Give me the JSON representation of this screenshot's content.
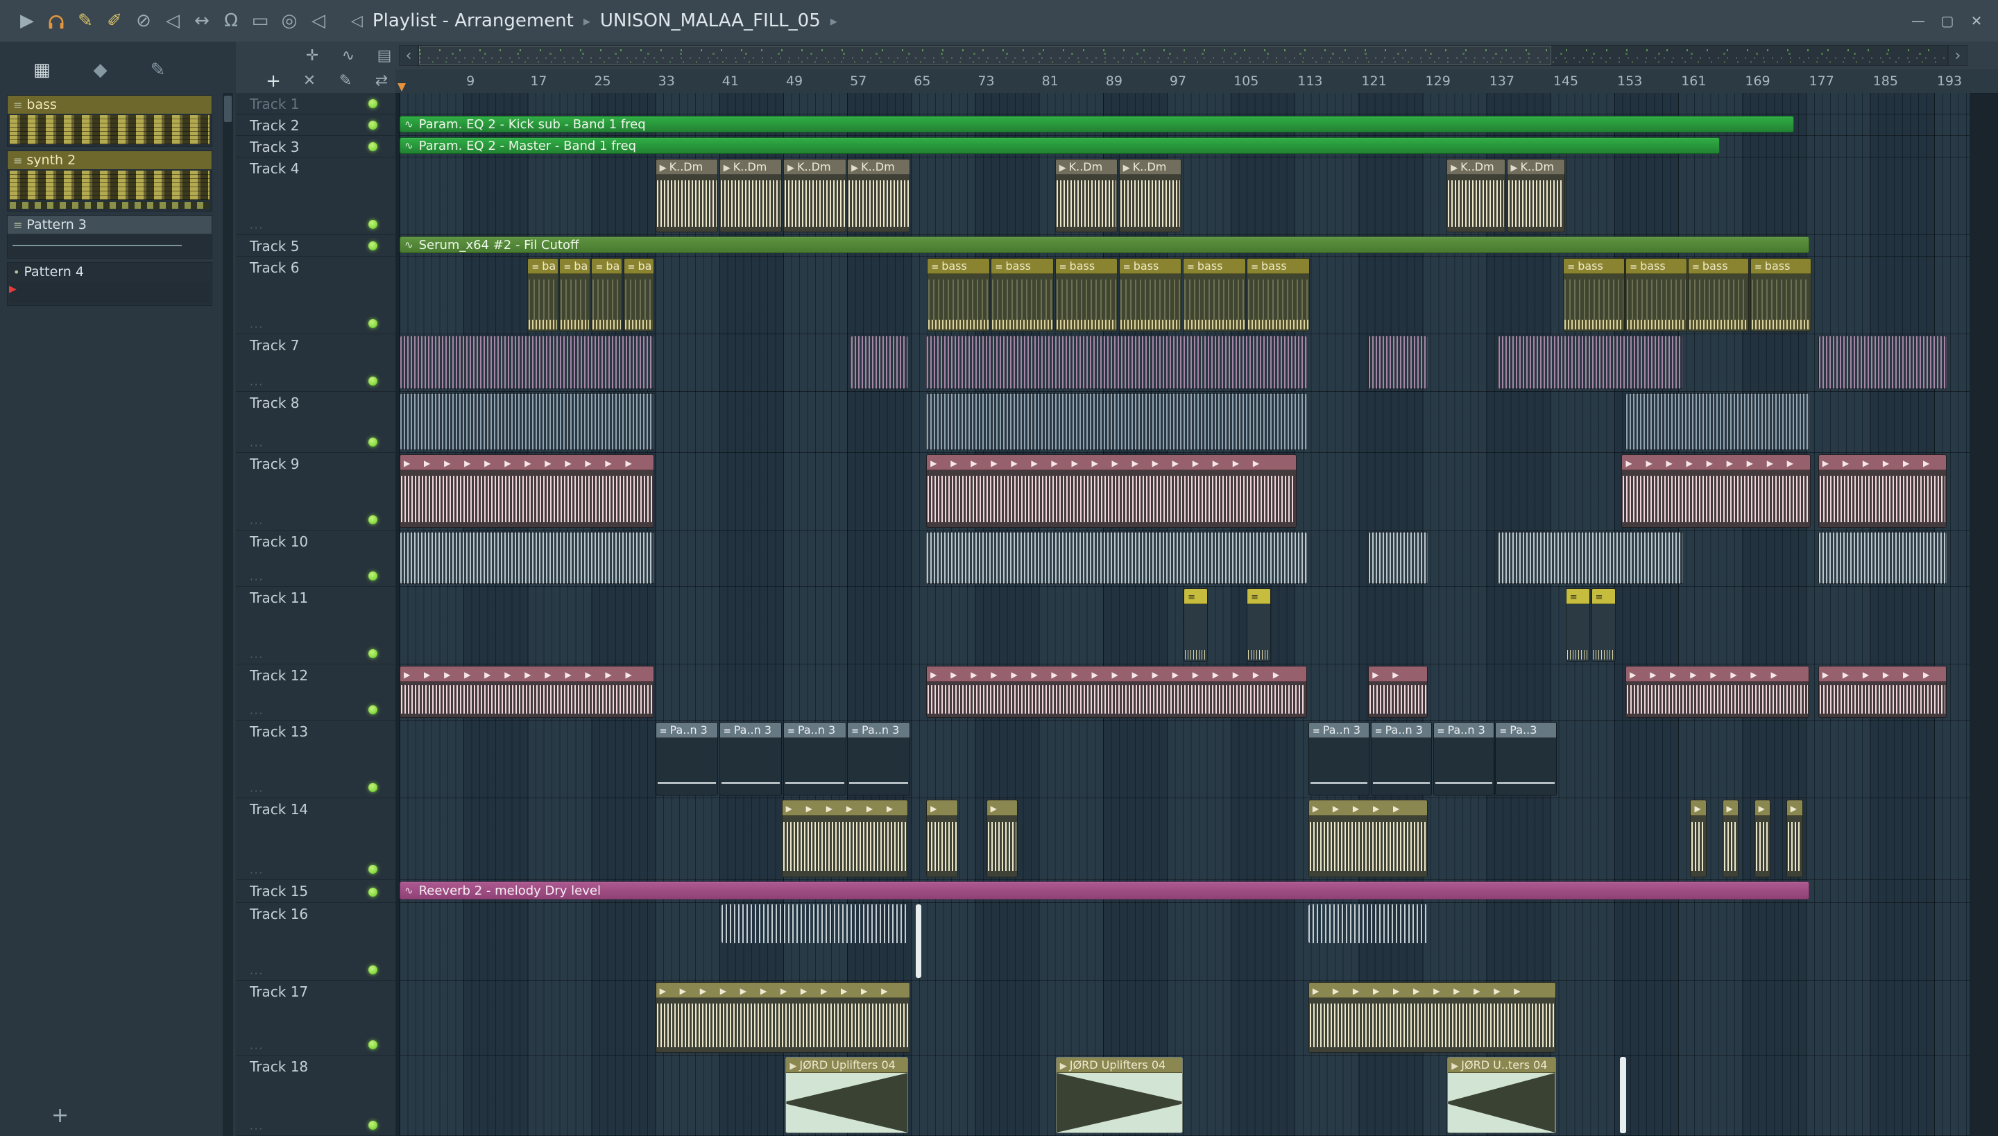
{
  "titlebar": {
    "title": "Playlist - Arrangement",
    "separator": "▸",
    "subtitle": "UNISON_MALAA_FILL_05",
    "speaker_glyph": "◁",
    "window_buttons": {
      "minimize": "—",
      "maximize": "▢",
      "close": "✕"
    },
    "icons": [
      {
        "name": "play",
        "glyph": "▶"
      },
      {
        "name": "headphones",
        "glyph": "svg"
      },
      {
        "name": "pencil",
        "glyph": "✎",
        "warn": true
      },
      {
        "name": "brush",
        "glyph": "✐",
        "warn": true
      },
      {
        "name": "slip",
        "glyph": "⊘"
      },
      {
        "name": "mute",
        "glyph": "◁"
      },
      {
        "name": "stretch",
        "glyph": "↔"
      },
      {
        "name": "magnet",
        "glyph": "Ω"
      },
      {
        "name": "zoom-frame",
        "glyph": "▭"
      },
      {
        "name": "zoom",
        "glyph": "◎"
      },
      {
        "name": "preview-speaker",
        "glyph": "◁"
      }
    ]
  },
  "pattern_picker": {
    "tools": [
      {
        "name": "grid",
        "glyph": "▦",
        "bright": true
      },
      {
        "name": "diamond",
        "glyph": "◆"
      },
      {
        "name": "pencil",
        "glyph": "✎"
      }
    ],
    "items": [
      {
        "label": "bass",
        "kind": "notes",
        "icon": "≡"
      },
      {
        "label": "synth 2",
        "kind": "notes2",
        "icon": "≡"
      },
      {
        "label": "Pattern 3",
        "kind": "empty",
        "icon": "≡"
      },
      {
        "label": "Pattern 4",
        "kind": "audio",
        "icon": "•"
      }
    ],
    "add_button": "+"
  },
  "playlist_tools": {
    "row1": [
      {
        "name": "move",
        "glyph": "✛"
      },
      {
        "name": "slide",
        "glyph": "∿"
      },
      {
        "name": "piano",
        "glyph": "▤"
      }
    ],
    "row2": [
      {
        "name": "add",
        "glyph": "+",
        "accent": true
      },
      {
        "name": "cut",
        "glyph": "✕"
      },
      {
        "name": "draw",
        "glyph": "✎"
      },
      {
        "name": "swap",
        "glyph": "⇄"
      }
    ]
  },
  "scrollbar": {
    "left_arrow": "‹",
    "right_arrow": "›"
  },
  "timeline": {
    "labels": [
      9,
      17,
      25,
      33,
      41,
      49,
      57,
      65,
      73,
      81,
      89,
      97,
      105,
      113,
      121,
      129,
      137,
      145,
      153,
      161,
      169,
      177,
      185,
      193
    ]
  },
  "tracks": [
    {
      "name": "Track 1",
      "h": 31,
      "dim": true
    },
    {
      "name": "Track 2",
      "h": 31
    },
    {
      "name": "Track 3",
      "h": 31
    },
    {
      "name": "Track 4",
      "h": 112
    },
    {
      "name": "Track 5",
      "h": 31
    },
    {
      "name": "Track 6",
      "h": 112
    },
    {
      "name": "Track 7",
      "h": 83
    },
    {
      "name": "Track 8",
      "h": 88
    },
    {
      "name": "Track 9",
      "h": 112
    },
    {
      "name": "Track 10",
      "h": 81
    },
    {
      "name": "Track 11",
      "h": 112
    },
    {
      "name": "Track 12",
      "h": 81
    },
    {
      "name": "Track 13",
      "h": 112
    },
    {
      "name": "Track 14",
      "h": 118
    },
    {
      "name": "Track 15",
      "h": 33
    },
    {
      "name": "Track 16",
      "h": 112
    },
    {
      "name": "Track 17",
      "h": 108
    },
    {
      "name": "Track 18",
      "h": 116
    }
  ],
  "palette": {
    "auto_green": {
      "fill": "#2fae44",
      "fill2": "#238233",
      "border": "#0f5c1e",
      "icon": "∿",
      "text": "#eef7ea"
    },
    "auto_olive": {
      "fill": "#5e9440",
      "fill2": "#497a30",
      "border": "#2f5a1c",
      "icon": "∿",
      "text": "#eef7ea"
    },
    "auto_purple": {
      "fill": "#ad5890",
      "fill2": "#8f4276",
      "border": "#6b2f58",
      "icon": "∿",
      "text": "#f7eef4"
    },
    "bass": {
      "hdr": "#8a8430",
      "body": "#3f4530",
      "bars": "#d8d2a0",
      "icon": "≡",
      "text": "#efe9c8"
    },
    "kick": {
      "hdr": "#716e5e",
      "body": "#3e4036",
      "bars": "#ece6ca",
      "icon": "▶",
      "text": "#efe9d8"
    },
    "stripe_purple": {
      "a": "#a386a8",
      "b": "#2a3640"
    },
    "stripe_blue": {
      "a": "#8fa3b2",
      "b": "#2a3640"
    },
    "stripe_light": {
      "a": "#b9c6cd",
      "b": "#2f3d46"
    },
    "wave_pink": {
      "hdr": "#96606c",
      "body": "#433a3e",
      "bars": "#f0d6da",
      "text": "#f6e8ea"
    },
    "yellow_sm": {
      "hdr": "#c6bd3e",
      "body": "#2b3a43",
      "bars": "#ded8a8",
      "icon": "≡",
      "text": "#2e2e1a"
    },
    "pat3": {
      "hdr": "#667882",
      "body": "#22303a",
      "icon": "≡",
      "text": "#e8eef2"
    },
    "wave_olive": {
      "hdr": "#8a8750",
      "body": "#3e4236",
      "bars": "#ece6ca",
      "text": "#f0ead2"
    },
    "wave_thin": {
      "bars": "#c4ced2"
    },
    "uplift": {
      "hdr": "#8a8750",
      "body": "#d2e4d4",
      "ramp": "#3a4234",
      "icon": "▶",
      "text": "#f0ead2"
    },
    "sliver": {
      "fill": "#e8eef0"
    }
  },
  "clips": [
    {
      "t": 2,
      "s": 1,
      "l": 174.6,
      "k": "auto_green",
      "label": "Param. EQ 2 - Kick sub - Band 1 freq"
    },
    {
      "t": 3,
      "s": 1,
      "l": 165.3,
      "k": "auto_green",
      "label": "Param. EQ 2 - Master - Band 1 freq"
    },
    {
      "t": 4,
      "s": 33,
      "l": 8,
      "k": "kick",
      "label": "K..Dm"
    },
    {
      "t": 4,
      "s": 41,
      "l": 8,
      "k": "kick",
      "label": "K..Dm"
    },
    {
      "t": 4,
      "s": 49,
      "l": 8,
      "k": "kick",
      "label": "K..Dm"
    },
    {
      "t": 4,
      "s": 57,
      "l": 8,
      "k": "kick",
      "label": "K..Dm"
    },
    {
      "t": 4,
      "s": 83,
      "l": 8,
      "k": "kick",
      "label": "K..Dm"
    },
    {
      "t": 4,
      "s": 91,
      "l": 8,
      "k": "kick",
      "label": "K..Dm"
    },
    {
      "t": 4,
      "s": 132,
      "l": 7.5,
      "k": "kick",
      "label": "K..Dm"
    },
    {
      "t": 4,
      "s": 139.5,
      "l": 7.5,
      "k": "kick",
      "label": "K..Dm"
    },
    {
      "t": 5,
      "s": 1,
      "l": 176.5,
      "k": "auto_olive",
      "label": "Serum_x64 #2 - Fil Cutoff"
    },
    {
      "t": 6,
      "s": 17,
      "l": 4,
      "k": "bass",
      "label": "ba"
    },
    {
      "t": 6,
      "s": 21,
      "l": 4,
      "k": "bass",
      "label": "ba"
    },
    {
      "t": 6,
      "s": 25,
      "l": 4,
      "k": "bass",
      "label": "ba"
    },
    {
      "t": 6,
      "s": 29,
      "l": 4,
      "k": "bass",
      "label": "ba"
    },
    {
      "t": 6,
      "s": 67,
      "l": 8,
      "k": "bass",
      "label": "bass"
    },
    {
      "t": 6,
      "s": 75,
      "l": 8,
      "k": "bass",
      "label": "bass"
    },
    {
      "t": 6,
      "s": 83,
      "l": 8,
      "k": "bass",
      "label": "bass"
    },
    {
      "t": 6,
      "s": 91,
      "l": 8,
      "k": "bass",
      "label": "bass"
    },
    {
      "t": 6,
      "s": 99,
      "l": 8,
      "k": "bass",
      "label": "bass"
    },
    {
      "t": 6,
      "s": 107,
      "l": 8,
      "k": "bass",
      "label": "bass"
    },
    {
      "t": 6,
      "s": 146.6,
      "l": 7.8,
      "k": "bass",
      "label": "bass"
    },
    {
      "t": 6,
      "s": 154.4,
      "l": 7.8,
      "k": "bass",
      "label": "bass"
    },
    {
      "t": 6,
      "s": 162.2,
      "l": 7.8,
      "k": "bass",
      "label": "bass"
    },
    {
      "t": 6,
      "s": 170,
      "l": 7.8,
      "k": "bass",
      "label": "bass"
    },
    {
      "t": 7,
      "s": 1,
      "l": 32,
      "k": "stripe_purple"
    },
    {
      "t": 7,
      "s": 57.4,
      "l": 7.4,
      "k": "stripe_purple"
    },
    {
      "t": 7,
      "s": 66.9,
      "l": 47.8,
      "k": "stripe_purple"
    },
    {
      "t": 7,
      "s": 122.2,
      "l": 7.6,
      "k": "stripe_purple"
    },
    {
      "t": 7,
      "s": 138.4,
      "l": 23.3,
      "k": "stripe_purple"
    },
    {
      "t": 7,
      "s": 178.5,
      "l": 16.2,
      "k": "stripe_purple"
    },
    {
      "t": 8,
      "s": 1,
      "l": 32,
      "k": "stripe_blue"
    },
    {
      "t": 8,
      "s": 66.9,
      "l": 47.8,
      "k": "stripe_blue"
    },
    {
      "t": 8,
      "s": 154.4,
      "l": 23.1,
      "k": "stripe_blue"
    },
    {
      "t": 9,
      "s": 1,
      "l": 32,
      "k": "wave_pink"
    },
    {
      "t": 9,
      "s": 66.9,
      "l": 46.5,
      "k": "wave_pink"
    },
    {
      "t": 9,
      "s": 153.9,
      "l": 23.8,
      "k": "wave_pink"
    },
    {
      "t": 9,
      "s": 178.5,
      "l": 16.2,
      "k": "wave_pink"
    },
    {
      "t": 10,
      "s": 1,
      "l": 32,
      "k": "stripe_light"
    },
    {
      "t": 10,
      "s": 66.9,
      "l": 47.8,
      "k": "stripe_light"
    },
    {
      "t": 10,
      "s": 122.2,
      "l": 7.6,
      "k": "stripe_light"
    },
    {
      "t": 10,
      "s": 138.4,
      "l": 23.3,
      "k": "stripe_light"
    },
    {
      "t": 10,
      "s": 178.5,
      "l": 16.2,
      "k": "stripe_light"
    },
    {
      "t": 11,
      "s": 99.1,
      "l": 3.2,
      "k": "yellow_sm"
    },
    {
      "t": 11,
      "s": 107,
      "l": 3.2,
      "k": "yellow_sm"
    },
    {
      "t": 11,
      "s": 146.9,
      "l": 3.2,
      "k": "yellow_sm"
    },
    {
      "t": 11,
      "s": 150.1,
      "l": 3.2,
      "k": "yellow_sm"
    },
    {
      "t": 12,
      "s": 1,
      "l": 32,
      "k": "wave_pink"
    },
    {
      "t": 12,
      "s": 66.9,
      "l": 47.8,
      "k": "wave_pink"
    },
    {
      "t": 12,
      "s": 122.2,
      "l": 7.6,
      "k": "wave_pink"
    },
    {
      "t": 12,
      "s": 154.4,
      "l": 23.1,
      "k": "wave_pink"
    },
    {
      "t": 12,
      "s": 178.5,
      "l": 16.2,
      "k": "wave_pink"
    },
    {
      "t": 13,
      "s": 33,
      "l": 8,
      "k": "pat3",
      "label": "Pa..n 3"
    },
    {
      "t": 13,
      "s": 41,
      "l": 8,
      "k": "pat3",
      "label": "Pa..n 3"
    },
    {
      "t": 13,
      "s": 49,
      "l": 8,
      "k": "pat3",
      "label": "Pa..n 3"
    },
    {
      "t": 13,
      "s": 57,
      "l": 8,
      "k": "pat3",
      "label": "Pa..n 3"
    },
    {
      "t": 13,
      "s": 114.7,
      "l": 7.8,
      "k": "pat3",
      "label": "Pa..n 3"
    },
    {
      "t": 13,
      "s": 122.5,
      "l": 7.8,
      "k": "pat3",
      "label": "Pa..n 3"
    },
    {
      "t": 13,
      "s": 130.3,
      "l": 7.8,
      "k": "pat3",
      "label": "Pa..n 3"
    },
    {
      "t": 13,
      "s": 138.1,
      "l": 7.8,
      "k": "pat3",
      "label": "Pa..3"
    },
    {
      "t": 14,
      "s": 48.8,
      "l": 16,
      "k": "wave_olive"
    },
    {
      "t": 14,
      "s": 66.9,
      "l": 4.1,
      "k": "wave_olive"
    },
    {
      "t": 14,
      "s": 74.4,
      "l": 4.1,
      "k": "wave_olive"
    },
    {
      "t": 14,
      "s": 114.7,
      "l": 15.1,
      "k": "wave_olive"
    },
    {
      "t": 14,
      "s": 162.5,
      "l": 2.2,
      "k": "wave_olive"
    },
    {
      "t": 14,
      "s": 166.5,
      "l": 2.2,
      "k": "wave_olive"
    },
    {
      "t": 14,
      "s": 170.5,
      "l": 2.2,
      "k": "wave_olive"
    },
    {
      "t": 14,
      "s": 174.5,
      "l": 2.2,
      "k": "wave_olive"
    },
    {
      "t": 15,
      "s": 1,
      "l": 176.5,
      "k": "auto_purple",
      "label": "Reeverb 2 - melody Dry level"
    },
    {
      "t": 16,
      "s": 41.3,
      "l": 23.5,
      "k": "wave_thin"
    },
    {
      "t": 16,
      "s": 65.6,
      "l": 0.8,
      "k": "sliver"
    },
    {
      "t": 16,
      "s": 114.7,
      "l": 15.1,
      "k": "wave_thin"
    },
    {
      "t": 17,
      "s": 33,
      "l": 32,
      "k": "wave_olive"
    },
    {
      "t": 17,
      "s": 114.7,
      "l": 31.1,
      "k": "wave_olive"
    },
    {
      "t": 18,
      "s": 49.3,
      "l": 15.5,
      "k": "uplift",
      "label": "JØRD Uplifters 04",
      "dir": "up"
    },
    {
      "t": 18,
      "s": 83.1,
      "l": 16,
      "k": "uplift",
      "label": "JØRD Uplifters 04",
      "dir": "down"
    },
    {
      "t": 18,
      "s": 132.1,
      "l": 13.7,
      "k": "uplift",
      "label": "JØRD U..ters 04",
      "dir": "up"
    },
    {
      "t": 18,
      "s": 153.7,
      "l": 0.9,
      "k": "sliver"
    }
  ]
}
